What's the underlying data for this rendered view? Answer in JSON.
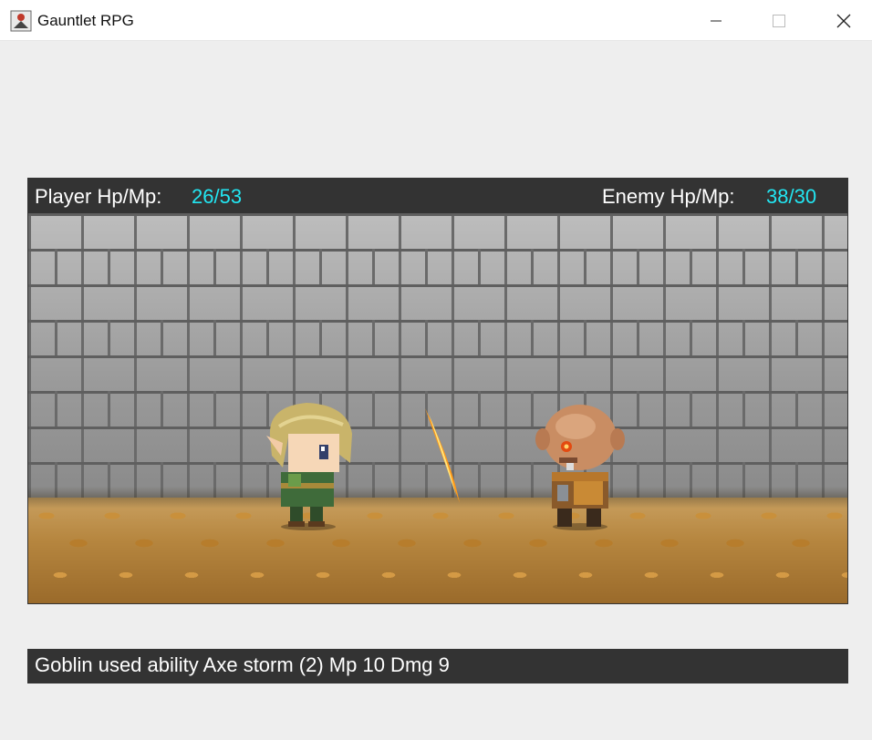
{
  "window": {
    "title": "Gauntlet RPG",
    "icon": "rpg-app-icon",
    "controls": [
      "minimize-icon",
      "maximize-icon",
      "close-icon"
    ]
  },
  "status": {
    "player_label": "Player Hp/Mp:",
    "player_value": "26/53",
    "enemy_label": "Enemy Hp/Mp:",
    "enemy_value": "38/30"
  },
  "scene": {
    "player_sprite": "elf-hero-sprite",
    "enemy_sprite": "goblin-sprite",
    "effect": "slash-effect"
  },
  "log": {
    "message": "Goblin used ability Axe storm (2) Mp 10 Dmg 9"
  },
  "colors": {
    "bar_bg": "#333333",
    "label_text": "#ffffff",
    "value_text": "#22e6f2",
    "window_bg": "#eeeeee"
  }
}
